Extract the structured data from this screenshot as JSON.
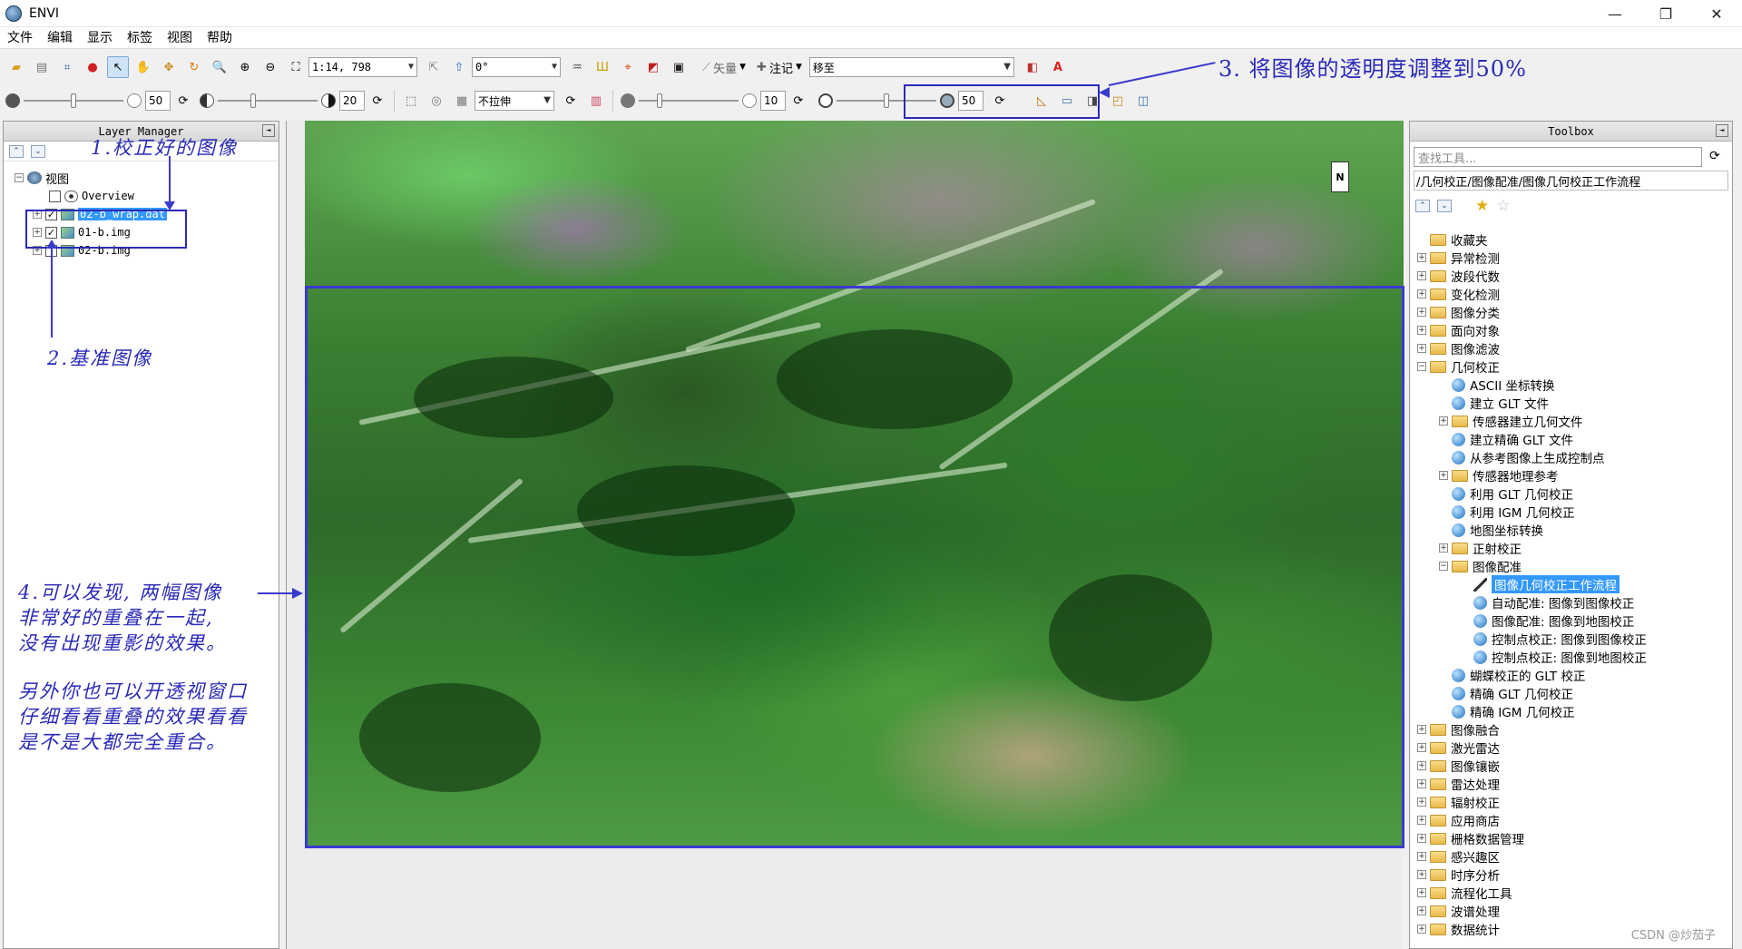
{
  "window": {
    "title": "ENVI",
    "controls": [
      "—",
      "❐",
      "✕"
    ]
  },
  "menu": [
    "文件",
    "编辑",
    "显示",
    "标签",
    "视图",
    "帮助"
  ],
  "toolbar1": {
    "scale": "1:14, 798",
    "rotation": "0°",
    "vector_label": "矢量",
    "annotation_label": "注记",
    "goto": "移至"
  },
  "toolbar2": {
    "brightness": "50",
    "contrast": "20",
    "stretch": "不拉伸",
    "sharpen": "10",
    "transparency": "50"
  },
  "layer_manager": {
    "title": "Layer Manager",
    "root": "视图",
    "items": [
      "Overview",
      "02-b_wrap.dat",
      "01-b.img",
      "02-b.img"
    ]
  },
  "toolbox": {
    "title": "Toolbox",
    "search_placeholder": "查找工具...",
    "path": "/几何校正/图像配准/图像几何校正工作流程",
    "tree": [
      {
        "label": "收藏夹",
        "level": 0,
        "type": "folder",
        "exp": ""
      },
      {
        "label": "异常检测",
        "level": 0,
        "type": "folder",
        "exp": "+"
      },
      {
        "label": "波段代数",
        "level": 0,
        "type": "folder",
        "exp": "+"
      },
      {
        "label": "变化检测",
        "level": 0,
        "type": "folder",
        "exp": "+"
      },
      {
        "label": "图像分类",
        "level": 0,
        "type": "folder",
        "exp": "+"
      },
      {
        "label": "面向对象",
        "level": 0,
        "type": "folder",
        "exp": "+"
      },
      {
        "label": "图像滤波",
        "level": 0,
        "type": "folder",
        "exp": "+"
      },
      {
        "label": "几何校正",
        "level": 0,
        "type": "folder",
        "exp": "−"
      },
      {
        "label": "ASCII 坐标转换",
        "level": 1,
        "type": "tool",
        "exp": ""
      },
      {
        "label": "建立 GLT 文件",
        "level": 1,
        "type": "tool",
        "exp": ""
      },
      {
        "label": "传感器建立几何文件",
        "level": 1,
        "type": "folder",
        "exp": "+"
      },
      {
        "label": "建立精确 GLT 文件",
        "level": 1,
        "type": "tool",
        "exp": ""
      },
      {
        "label": "从参考图像上生成控制点",
        "level": 1,
        "type": "tool",
        "exp": ""
      },
      {
        "label": "传感器地理参考",
        "level": 1,
        "type": "folder",
        "exp": "+"
      },
      {
        "label": "利用 GLT 几何校正",
        "level": 1,
        "type": "tool",
        "exp": ""
      },
      {
        "label": "利用 IGM 几何校正",
        "level": 1,
        "type": "tool",
        "exp": ""
      },
      {
        "label": "地图坐标转换",
        "level": 1,
        "type": "tool",
        "exp": ""
      },
      {
        "label": "正射校正",
        "level": 1,
        "type": "folder",
        "exp": "+"
      },
      {
        "label": "图像配准",
        "level": 1,
        "type": "folder",
        "exp": "−"
      },
      {
        "label": "图像几何校正工作流程",
        "level": 2,
        "type": "pen",
        "exp": "",
        "selected": true
      },
      {
        "label": "自动配准: 图像到图像校正",
        "level": 2,
        "type": "tool",
        "exp": ""
      },
      {
        "label": "图像配准: 图像到地图校正",
        "level": 2,
        "type": "tool",
        "exp": ""
      },
      {
        "label": "控制点校正: 图像到图像校正",
        "level": 2,
        "type": "tool",
        "exp": ""
      },
      {
        "label": "控制点校正: 图像到地图校正",
        "level": 2,
        "type": "tool",
        "exp": ""
      },
      {
        "label": "蝴蝶校正的 GLT 校正",
        "level": 1,
        "type": "tool",
        "exp": ""
      },
      {
        "label": "精确 GLT 几何校正",
        "level": 1,
        "type": "tool",
        "exp": ""
      },
      {
        "label": "精确 IGM 几何校正",
        "level": 1,
        "type": "tool",
        "exp": ""
      },
      {
        "label": "图像融合",
        "level": 0,
        "type": "folder",
        "exp": "+"
      },
      {
        "label": "激光雷达",
        "level": 0,
        "type": "folder",
        "exp": "+"
      },
      {
        "label": "图像镶嵌",
        "level": 0,
        "type": "folder",
        "exp": "+"
      },
      {
        "label": "雷达处理",
        "level": 0,
        "type": "folder",
        "exp": "+"
      },
      {
        "label": "辐射校正",
        "level": 0,
        "type": "folder",
        "exp": "+"
      },
      {
        "label": "应用商店",
        "level": 0,
        "type": "folder",
        "exp": "+"
      },
      {
        "label": "栅格数据管理",
        "level": 0,
        "type": "folder",
        "exp": "+"
      },
      {
        "label": "感兴趣区",
        "level": 0,
        "type": "folder",
        "exp": "+"
      },
      {
        "label": "时序分析",
        "level": 0,
        "type": "folder",
        "exp": "+"
      },
      {
        "label": "流程化工具",
        "level": 0,
        "type": "folder",
        "exp": "+"
      },
      {
        "label": "波谱处理",
        "level": 0,
        "type": "folder",
        "exp": "+"
      },
      {
        "label": "数据统计",
        "level": 0,
        "type": "folder",
        "exp": "+"
      }
    ]
  },
  "annotations": {
    "a1": "1.校正好的图像",
    "a2": "2.基准图像",
    "a3": "3. 将图像的透明度调整到50%",
    "a4_lines": [
      "4.可以发现, 两幅图像",
      "非常好的重叠在一起,",
      "没有出现重影的效果。"
    ],
    "a5_lines": [
      "另外你也可以开透视窗口",
      "仔细看看重叠的效果看看",
      "是不是大都完全重合。"
    ]
  },
  "north_label": "N",
  "watermark": "CSDN @炒茄子",
  "colors": {
    "annotation": "#2a2ab8",
    "selection": "#3399ff"
  }
}
